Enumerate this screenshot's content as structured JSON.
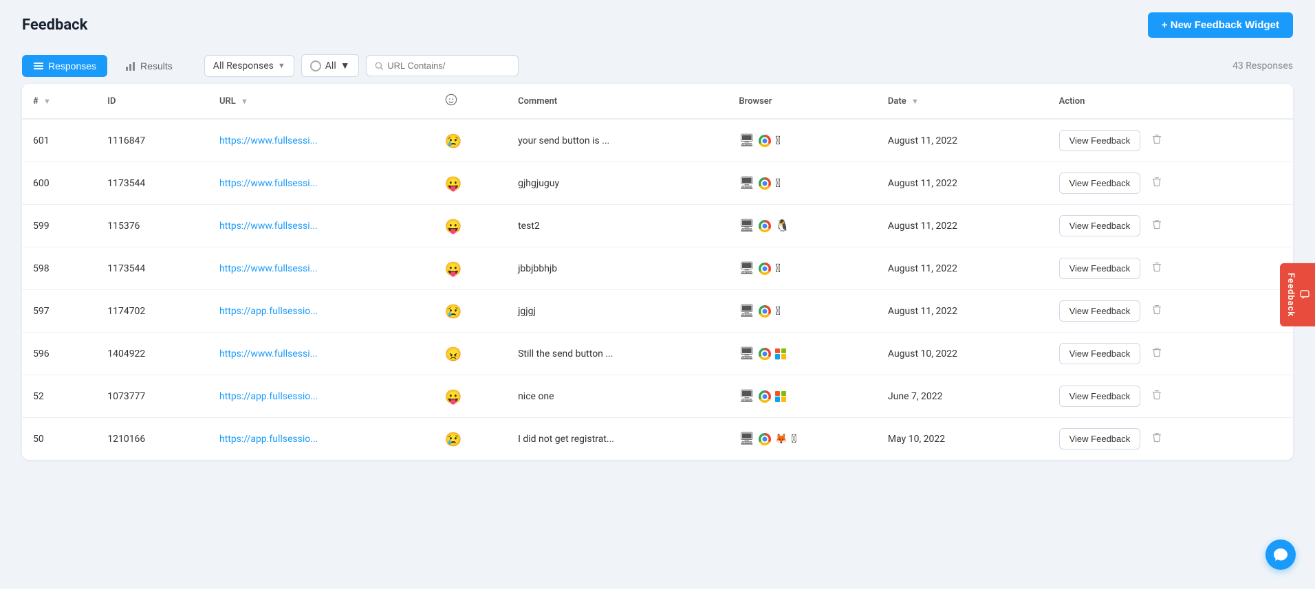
{
  "header": {
    "title": "Feedback",
    "new_widget_btn": "+ New Feedback Widget"
  },
  "toolbar": {
    "responses_tab": "Responses",
    "results_tab": "Results",
    "all_responses_label": "All Responses",
    "all_label": "All",
    "url_contains_placeholder": "URL Contains/",
    "response_count": "43 Responses"
  },
  "table": {
    "columns": [
      "#",
      "ID",
      "URL",
      "",
      "Comment",
      "Browser",
      "Date",
      "Action"
    ],
    "rows": [
      {
        "num": 601,
        "id": 1116847,
        "url": "https://www.fullsessi...",
        "emoji": "😢",
        "comment": "your send button is ...",
        "browser_desktop": true,
        "browser_chrome": true,
        "browser_os": "apple",
        "date": "August 11, 2022",
        "action": "View Feedback"
      },
      {
        "num": 600,
        "id": 1173544,
        "url": "https://www.fullsessi...",
        "emoji": "😛",
        "comment": "gjhgjuguy",
        "browser_desktop": true,
        "browser_chrome": true,
        "browser_os": "apple",
        "date": "August 11, 2022",
        "action": "View Feedback"
      },
      {
        "num": 599,
        "id": 115376,
        "url": "https://www.fullsessi...",
        "emoji": "😛",
        "comment": "test2",
        "browser_desktop": true,
        "browser_chrome": true,
        "browser_os": "linux",
        "date": "August 11, 2022",
        "action": "View Feedback"
      },
      {
        "num": 598,
        "id": 1173544,
        "url": "https://www.fullsessi...",
        "emoji": "😛",
        "comment": "jbbjbbhjb",
        "browser_desktop": true,
        "browser_chrome": true,
        "browser_os": "apple",
        "date": "August 11, 2022",
        "action": "View Feedback"
      },
      {
        "num": 597,
        "id": 1174702,
        "url": "https://app.fullsessio...",
        "emoji": "😢",
        "comment": "jgjgj",
        "browser_desktop": true,
        "browser_chrome": true,
        "browser_os": "apple",
        "date": "August 11, 2022",
        "action": "View Feedback"
      },
      {
        "num": 596,
        "id": 1404922,
        "url": "https://www.fullsessi...",
        "emoji": "😠",
        "comment": "Still the send button ...",
        "browser_desktop": true,
        "browser_chrome": true,
        "browser_os": "windows",
        "date": "August 10, 2022",
        "action": "View Feedback"
      },
      {
        "num": 52,
        "id": 1073777,
        "url": "https://app.fullsessio...",
        "emoji": "😛",
        "comment": "nice one",
        "browser_desktop": true,
        "browser_chrome": true,
        "browser_os": "windows",
        "date": "June 7, 2022",
        "action": "View Feedback"
      },
      {
        "num": 50,
        "id": 1210166,
        "url": "https://app.fullsessio...",
        "emoji": "😢",
        "comment": "I did not get registrat...",
        "browser_desktop": true,
        "browser_chrome": true,
        "browser_os": "apple",
        "browser_firefox": true,
        "date": "May 10, 2022",
        "action": "View Feedback"
      }
    ]
  },
  "side_tab": "Feedback",
  "icons": {
    "plus": "+",
    "responses_icon": "☰",
    "results_icon": "📊",
    "search_icon": "🔍",
    "sort_asc": "▼",
    "smiley": "☺",
    "sort_date": "▼"
  }
}
